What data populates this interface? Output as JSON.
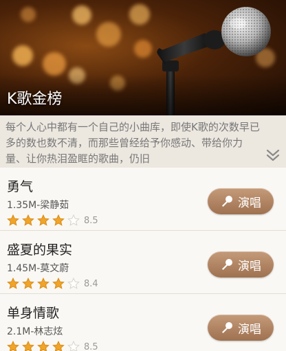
{
  "hero": {
    "title": "K歌金榜",
    "image_icon": "microphone-image"
  },
  "description": {
    "text": "每个人心中都有一个自己的小曲库，即使K歌的次数早已多的数也数不清，而那些曾经给予你感动、带给你力量、让你热泪盈眶的歌曲，仍旧",
    "expand_icon": "double-chevron-down-icon"
  },
  "songs": [
    {
      "name": "勇气",
      "meta": "1.35M-梁静茹",
      "stars": 4,
      "score": "8.5",
      "button": "演唱"
    },
    {
      "name": "盛夏的果实",
      "meta": "1.45M-莫文蔚",
      "stars": 4,
      "score": "8.4",
      "button": "演唱"
    },
    {
      "name": "单身情歌",
      "meta": "2.1M-林志炫",
      "stars": 4,
      "score": "8.5",
      "button": "演唱"
    }
  ],
  "colors": {
    "star_filled": "#f0a42a",
    "star_empty": "#ffffff",
    "button": "#b08563"
  }
}
